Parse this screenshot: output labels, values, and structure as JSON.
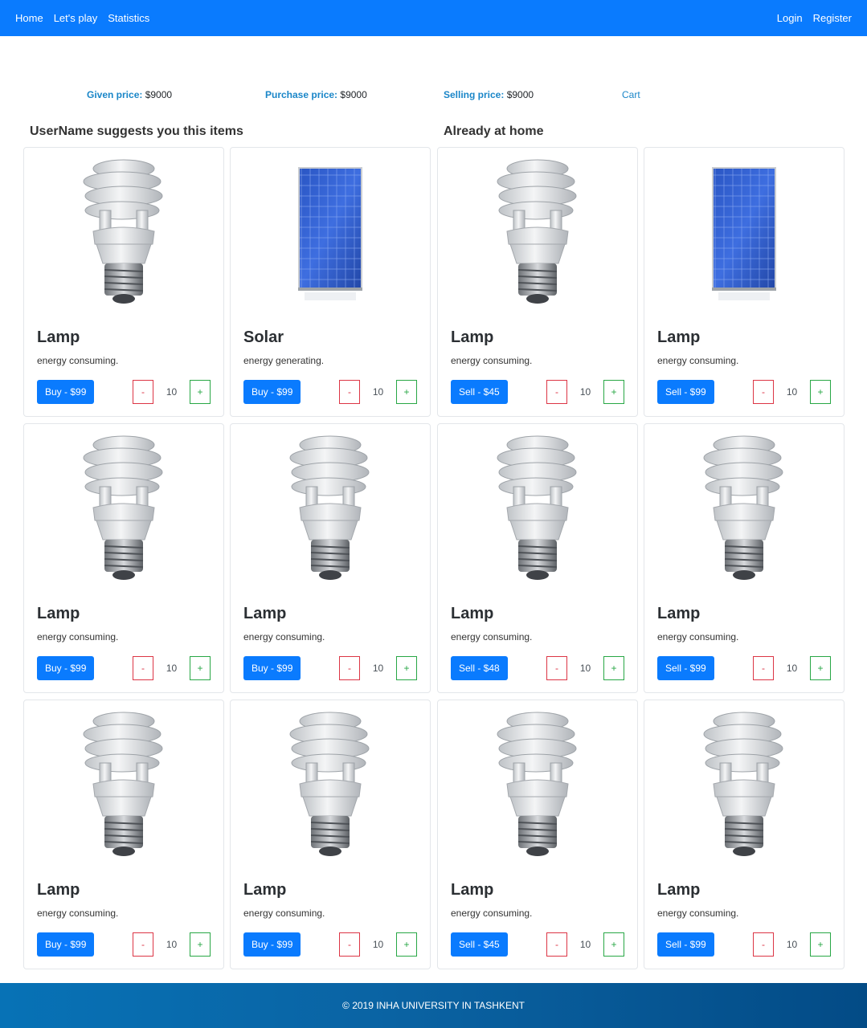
{
  "nav": {
    "left": [
      "Home",
      "Let's play",
      "Statistics"
    ],
    "right": [
      "Login",
      "Register"
    ]
  },
  "prices": {
    "given_label": "Given price:",
    "given_value": "$9000",
    "purchase_label": "Purchase price:",
    "purchase_value": "$9000",
    "selling_label": "Selling price:",
    "selling_value": "$9000",
    "cart": "Cart"
  },
  "sections": {
    "suggest": "UserName suggests you this items",
    "home": "Already at home"
  },
  "cards": [
    {
      "type": "lamp",
      "title": "Lamp",
      "desc": "energy consuming.",
      "btn": "Buy - $99",
      "qty": "10"
    },
    {
      "type": "solar",
      "title": "Solar",
      "desc": "energy generating.",
      "btn": "Buy - $99",
      "qty": "10"
    },
    {
      "type": "lamp",
      "title": "Lamp",
      "desc": "energy consuming.",
      "btn": "Sell - $45",
      "qty": "10"
    },
    {
      "type": "solar",
      "title": "Lamp",
      "desc": "energy consuming.",
      "btn": "Sell - $99",
      "qty": "10"
    },
    {
      "type": "lamp",
      "title": "Lamp",
      "desc": "energy consuming.",
      "btn": "Buy - $99",
      "qty": "10"
    },
    {
      "type": "lamp",
      "title": "Lamp",
      "desc": "energy consuming.",
      "btn": "Buy - $99",
      "qty": "10"
    },
    {
      "type": "lamp",
      "title": "Lamp",
      "desc": "energy consuming.",
      "btn": "Sell - $48",
      "qty": "10"
    },
    {
      "type": "lamp",
      "title": "Lamp",
      "desc": "energy consuming.",
      "btn": "Sell - $99",
      "qty": "10"
    },
    {
      "type": "lamp",
      "title": "Lamp",
      "desc": "energy consuming.",
      "btn": "Buy - $99",
      "qty": "10"
    },
    {
      "type": "lamp",
      "title": "Lamp",
      "desc": "energy consuming.",
      "btn": "Buy - $99",
      "qty": "10"
    },
    {
      "type": "lamp",
      "title": "Lamp",
      "desc": "energy consuming.",
      "btn": "Sell - $45",
      "qty": "10"
    },
    {
      "type": "lamp",
      "title": "Lamp",
      "desc": "energy consuming.",
      "btn": "Sell - $99",
      "qty": "10"
    }
  ],
  "qty_controls": {
    "minus": "-",
    "plus": "+"
  },
  "footer": "© 2019 INHA UNIVERSITY IN TASHKENT",
  "colors": {
    "primary": "#0a7bfe",
    "danger": "#dc3545",
    "success": "#28a745",
    "label": "#1a86c8"
  }
}
